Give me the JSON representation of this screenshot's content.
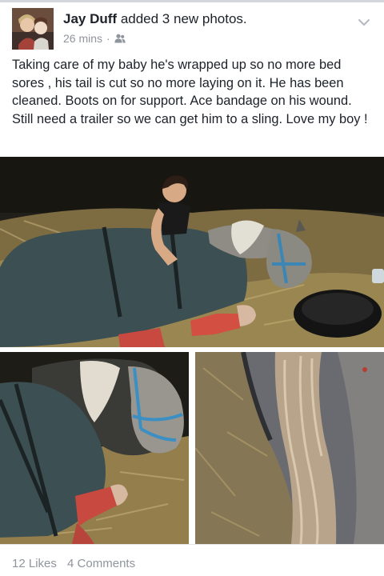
{
  "post": {
    "author_name": "Jay Duff",
    "action_text": "added 3 new photos.",
    "timestamp": "26 mins",
    "audience_icon": "friends-icon",
    "options_icon": "chevron-down-icon",
    "body_text": "Taking care of my baby he's wrapped up so no more bed sores , his tail is cut so no more laying on it. He has been cleaned. Boots on for support. Ace bandage on his wound. Still need a trailer so we can get him to a sling. Love my boy !"
  },
  "photos": [
    {
      "icon": "photo-woman-with-horse"
    },
    {
      "icon": "photo-horse-head-blanket"
    },
    {
      "icon": "photo-horse-tail"
    }
  ],
  "footer": {
    "likes": "12 Likes",
    "comments": "4 Comments"
  },
  "colors": {
    "text": "#1d2129",
    "meta": "#90949c",
    "blanket": "#3c4f52",
    "hay": "#a8925a",
    "boots": "#c8493f"
  }
}
